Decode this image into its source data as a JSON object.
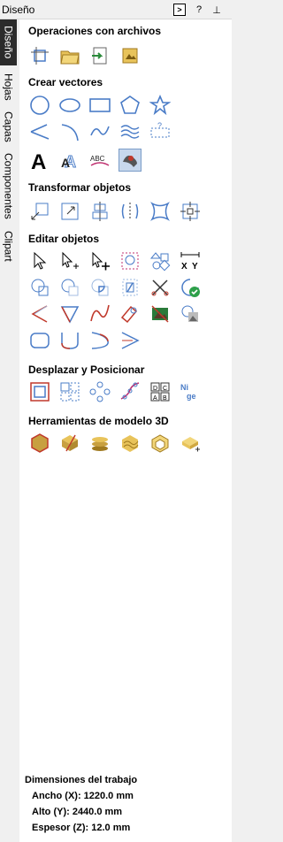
{
  "panel_title": "Diseño",
  "titlebar_buttons": {
    "dock": ">",
    "help": "?",
    "pin": "⊥"
  },
  "tabs": [
    "Diseño",
    "Hojas",
    "Capas",
    "Componentes",
    "Clipart"
  ],
  "sections": {
    "files": "Operaciones con archivos",
    "vectors": "Crear vectores",
    "transform": "Transformar objetos",
    "edit": "Editar objetos",
    "position": "Desplazar y Posicionar",
    "model3d": "Herramientas de modelo 3D"
  },
  "job": {
    "title": "Dimensiones del trabajo",
    "width": "Ancho   (X): 1220.0 mm",
    "height": "Alto    (Y): 2440.0 mm",
    "thickness": "Espesor (Z): 12.0 mm"
  },
  "colors": {
    "accent": "#4a7cc7",
    "dark": "#2b2b2b",
    "red": "#c0392b",
    "gold": "#c8a040"
  }
}
